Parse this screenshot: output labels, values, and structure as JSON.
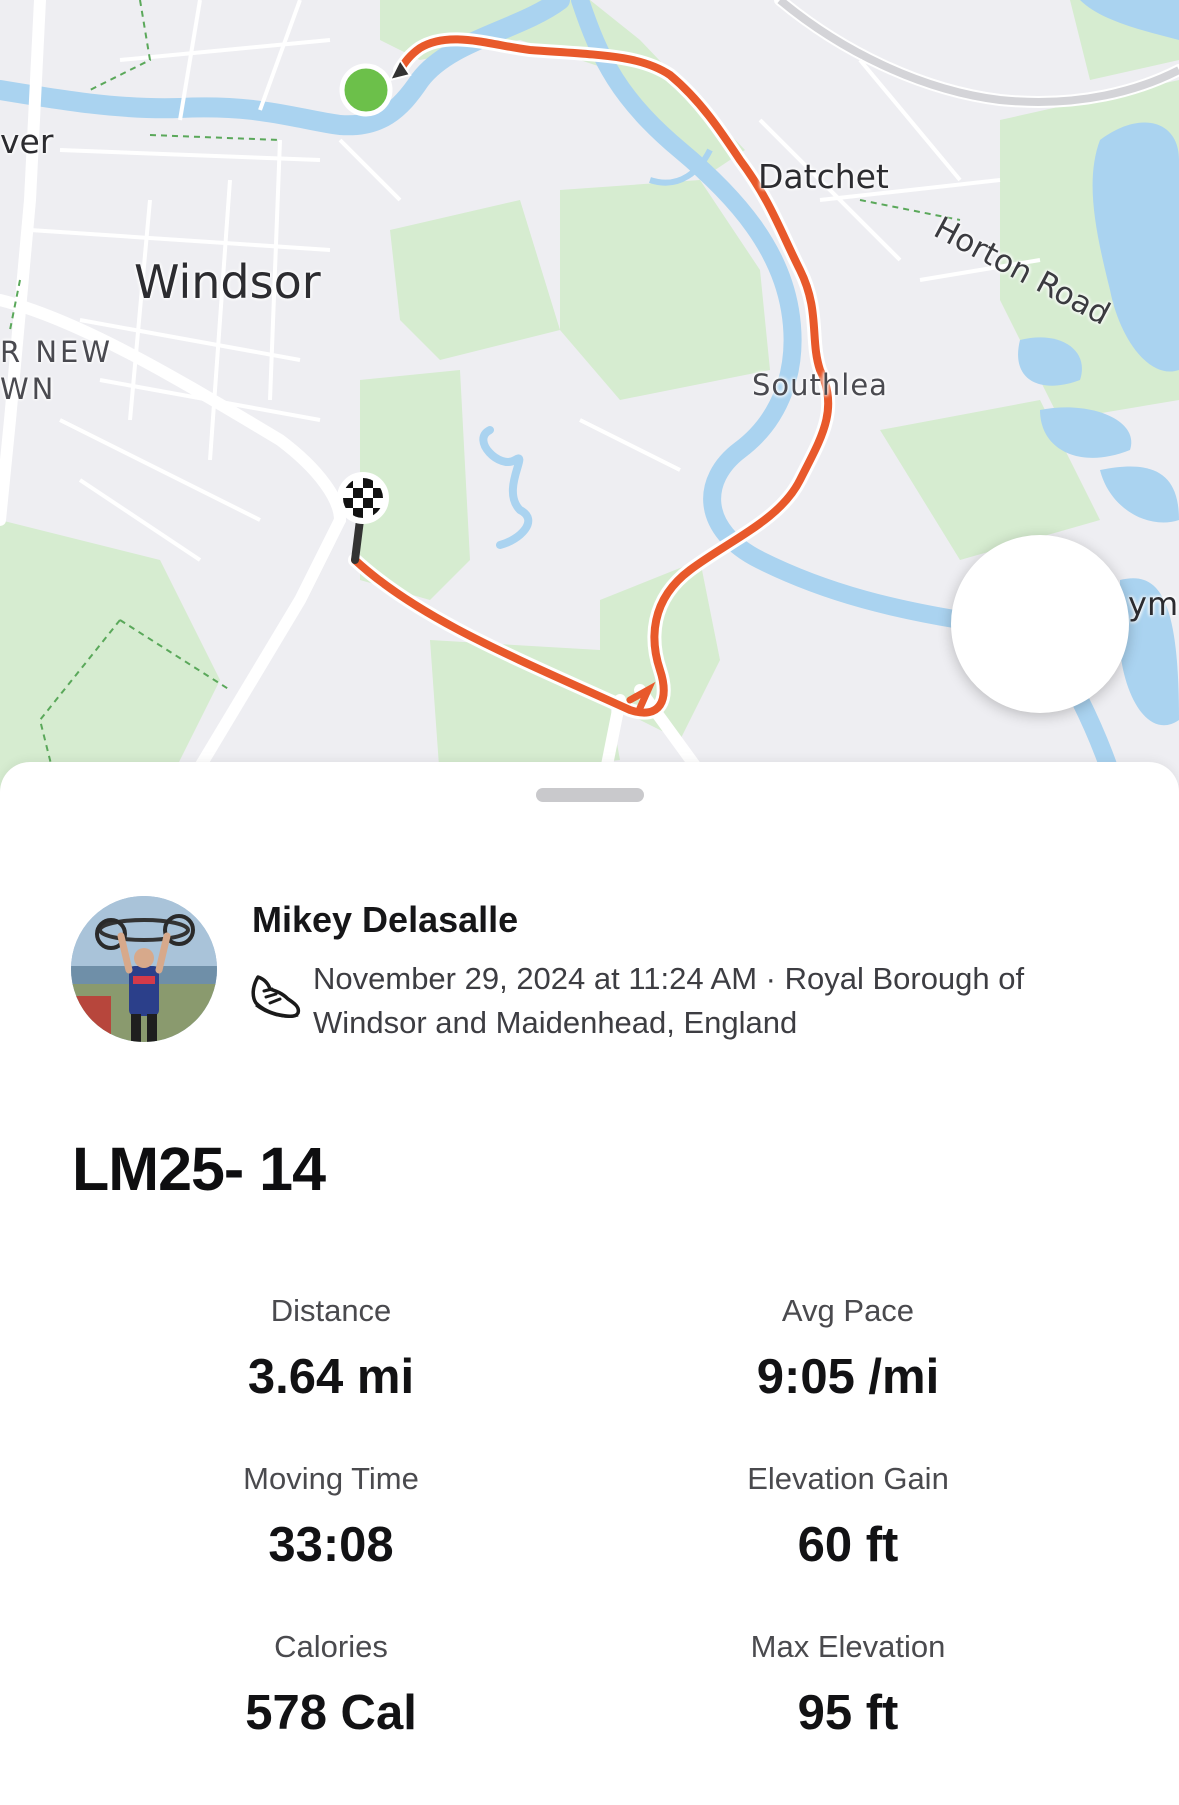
{
  "map": {
    "place_labels": {
      "windsor": "Windsor",
      "datchet": "Datchet",
      "horton_road": "Horton Road",
      "southlea": "Southlea",
      "river_fragment": "ver",
      "new_town_line1": "R NEW",
      "new_town_line2": "WN",
      "edge_fragment": "yme"
    },
    "route_color": "#e8592b",
    "start_marker_color": "#6cc04a",
    "water_color": "#aad3f0",
    "park_color": "#d6ecd0"
  },
  "play_button": {
    "icon": "play-icon"
  },
  "activity": {
    "athlete_name": "Mikey Delasalle",
    "sport_icon": "running-shoe-icon",
    "datetime_location": "November 29, 2024 at 11:24 AM · Royal Borough of Windsor and Maidenhead, England",
    "title": "LM25- 14"
  },
  "stats": {
    "distance": {
      "label": "Distance",
      "value": "3.64 mi"
    },
    "avg_pace": {
      "label": "Avg Pace",
      "value": "9:05 /mi"
    },
    "moving_time": {
      "label": "Moving Time",
      "value": "33:08"
    },
    "elevation_gain": {
      "label": "Elevation Gain",
      "value": "60 ft"
    },
    "calories": {
      "label": "Calories",
      "value": "578 Cal"
    },
    "max_elevation": {
      "label": "Max Elevation",
      "value": "95 ft"
    }
  }
}
